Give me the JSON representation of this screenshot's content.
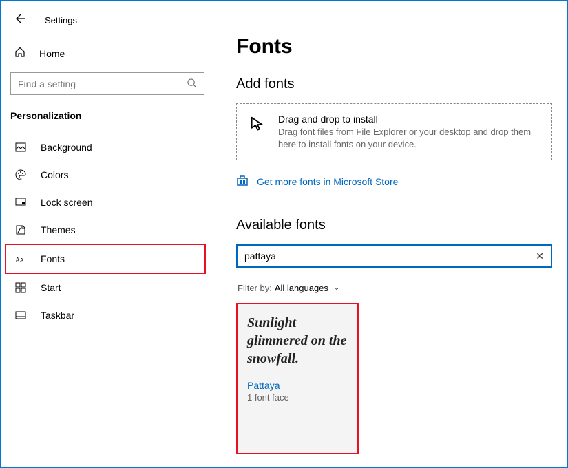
{
  "header": {
    "settings_label": "Settings"
  },
  "sidebar": {
    "home_label": "Home",
    "search_placeholder": "Find a setting",
    "category_label": "Personalization",
    "items": [
      {
        "label": "Background"
      },
      {
        "label": "Colors"
      },
      {
        "label": "Lock screen"
      },
      {
        "label": "Themes"
      },
      {
        "label": "Fonts",
        "selected": true
      },
      {
        "label": "Start"
      },
      {
        "label": "Taskbar"
      }
    ]
  },
  "main": {
    "title": "Fonts",
    "add_fonts_heading": "Add fonts",
    "dropzone": {
      "title": "Drag and drop to install",
      "desc": "Drag font files from File Explorer or your desktop and drop them here to install fonts on your device."
    },
    "store_link": "Get more fonts in Microsoft Store",
    "available_heading": "Available fonts",
    "search_value": "pattaya",
    "filter_label": "Filter by:",
    "filter_value": "All languages",
    "font_card": {
      "sample": "Sunlight glimmered on the snowfall.",
      "name": "Pattaya",
      "faces": "1 font face"
    }
  }
}
